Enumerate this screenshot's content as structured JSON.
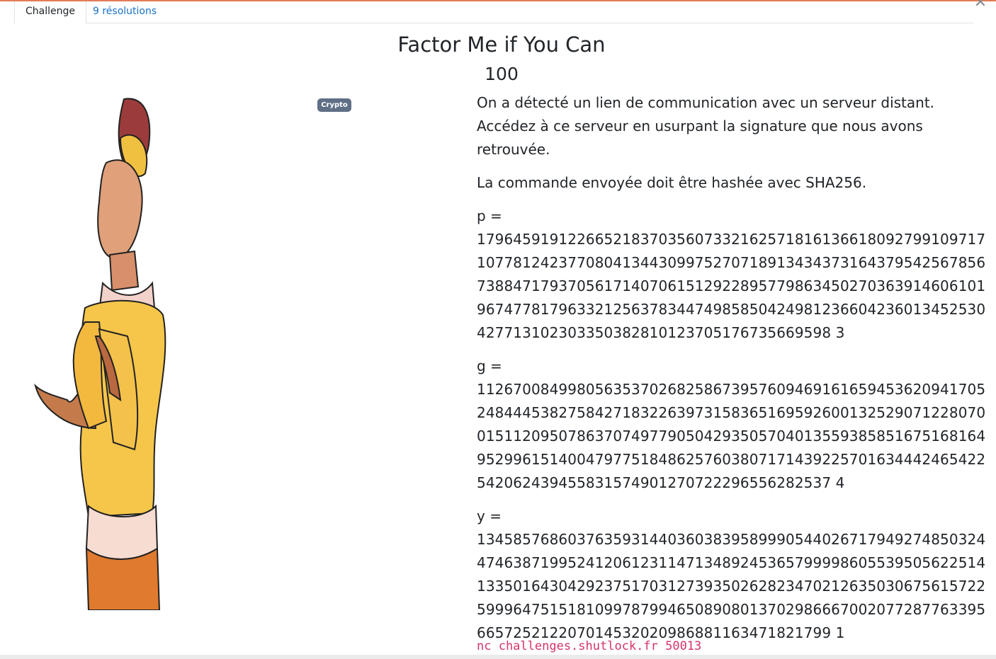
{
  "tabs": [
    {
      "label": "Challenge",
      "active": true
    },
    {
      "label": "9 résolutions",
      "active": false
    }
  ],
  "challenge": {
    "title": "Factor Me if You Can",
    "points": "100",
    "category": "Crypto",
    "description_1": "On a détecté un lien de communication avec un serveur distant. Accédez à ce serveur en usurpant la signature que nous avons retrouvée.",
    "description_2": "La commande envoyée doit être hashée avec SHA256.",
    "p_label": "p =",
    "p_value": "17964591912266521837035607332162571816136618092799109717107781242377080413443099752707189134343731643795425678567388471793705617140706151292289577986345027036391460610196747781796332125637834474985850424981236604236013452530427713102303350382810123705176735669598 3",
    "g_label": "g =",
    "g_value": "11267008499805635370268258673957609469161659453620941705248444538275842718322639731583651695926001325290712280700151120950786370749779050429350570401355938585167516816495299615140047977518486257603807171439225701634442465422542062439455831574901270722296556282537 4",
    "y_label": "y =",
    "y_value": "13458576860376359314403603839589990544026717949274850324474638719952412061231147134892453657999986055395056225141335016430429237517031273935026282347021263503067561572259996475151810997879946508908013702986667002077287763395665725212207014532020986881163471821799 1",
    "command": "nc challenges.shutlock.fr 50013"
  },
  "colors": {
    "accent_line": "#e27d5a",
    "link": "#1a73c8",
    "badge": "#5f6f86",
    "code": "#d6336c"
  }
}
